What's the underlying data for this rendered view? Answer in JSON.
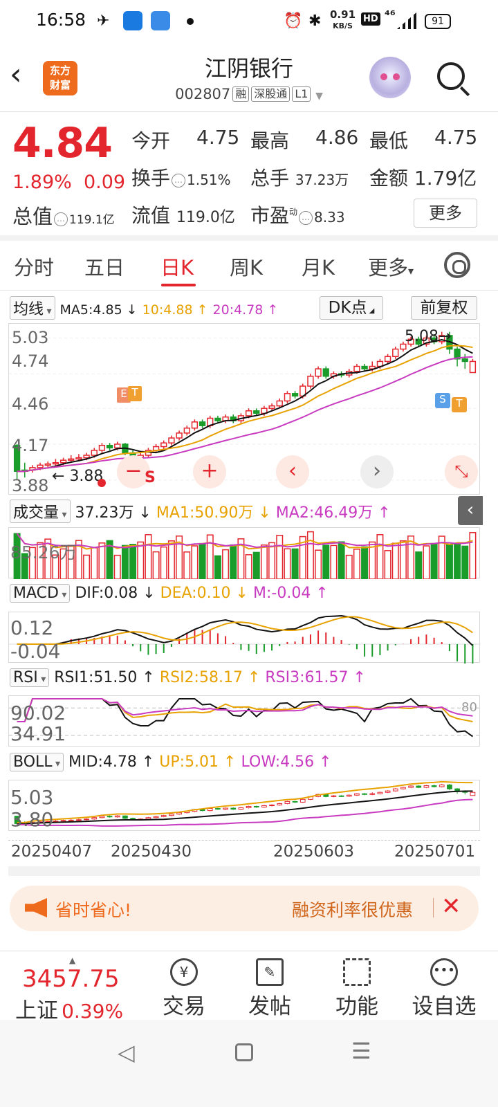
{
  "status_bar": {
    "time": "16:58",
    "speed_top": "0.91",
    "speed_bottom": "KB/S",
    "hd": "HD",
    "signal": "⁴⁶",
    "battery": "91"
  },
  "header": {
    "logo_line1": "东方",
    "logo_line2": "财富",
    "title": "江阴银行",
    "code": "002807",
    "tags": [
      "融",
      "深股通",
      "L1"
    ]
  },
  "quote": {
    "price": "4.84",
    "change_pct": "1.89%",
    "change_abs": "0.09",
    "open_label": "今开",
    "open": "4.75",
    "high_label": "最高",
    "high": "4.86",
    "low_label": "最低",
    "low": "4.75",
    "turnover_label": "换手",
    "turnover": "1.51%",
    "volume_label": "总手",
    "volume": "37.23万",
    "amount_label": "金额",
    "amount": "1.79亿",
    "mktcap_label": "总值",
    "mktcap": "119.1亿",
    "float_label": "流值",
    "float_cap": "119.0亿",
    "pe_label": "市盈",
    "pe_sup": "动",
    "pe": "8.33",
    "more": "更多"
  },
  "tabs": [
    {
      "label": "分时"
    },
    {
      "label": "五日"
    },
    {
      "label": "日K"
    },
    {
      "label": "周K"
    },
    {
      "label": "月K"
    },
    {
      "label": "更多"
    }
  ],
  "kline": {
    "selector": "均线",
    "ma5": "MA5:4.85",
    "ma10": "10:4.88",
    "ma20": "20:4.78",
    "dk_label": "DK点",
    "adjust_label": "前复权",
    "y_labels": [
      "5.03",
      "4.74",
      "4.46",
      "4.17",
      "3.88"
    ],
    "low_label": "3.88",
    "high_label": "5.08",
    "marker_e": "E",
    "marker_t": "T",
    "marker_s": "S",
    "marker_s2": "S"
  },
  "volume": {
    "selector": "成交量",
    "value": "37.23万",
    "ma1": "MA1:50.90万",
    "ma2": "MA2:46.49万",
    "axis_label": "85.26万"
  },
  "macd": {
    "selector": "MACD",
    "dif": "DIF:0.08",
    "dea": "DEA:0.10",
    "m": "M:-0.04",
    "axis_top": "0.12",
    "axis_bottom": "-0.04"
  },
  "rsi": {
    "selector": "RSI",
    "rsi1": "RSI1:51.50",
    "rsi2": "RSI2:58.17",
    "rsi3": "RSI3:61.57",
    "axis_top": "90.02",
    "axis_bottom": "34.91",
    "line_80": "80"
  },
  "boll": {
    "selector": "BOLL",
    "mid": "MID:4.78",
    "up": "UP:5.01",
    "low": "LOW:4.56",
    "axis_top": "5.03",
    "axis_bottom": "3.80"
  },
  "dates": [
    "20250407",
    "20250430",
    "20250603",
    "20250701"
  ],
  "ad": {
    "left_text": "省时省心!",
    "right_text": "融资利率很优惠"
  },
  "bottom_nav": {
    "index_value": "3457.75",
    "index_name": "上证",
    "index_pct": "0.39%",
    "items": [
      "交易",
      "发帖",
      "功能",
      "设自选"
    ]
  },
  "chart_data": {
    "type": "candlestick",
    "title": "",
    "ylim": [
      3.8,
      5.1
    ],
    "candles": [
      [
        4.16,
        3.95,
        4.17,
        3.88
      ],
      [
        3.96,
        3.95,
        4.02,
        3.9
      ],
      [
        3.96,
        3.98,
        4.0,
        3.94
      ],
      [
        3.98,
        4.0,
        4.02,
        3.96
      ],
      [
        4.0,
        4.01,
        4.03,
        3.98
      ],
      [
        4.01,
        4.02,
        4.05,
        3.99
      ],
      [
        4.02,
        4.04,
        4.06,
        4.0
      ],
      [
        4.04,
        4.05,
        4.08,
        4.02
      ],
      [
        4.05,
        4.06,
        4.09,
        4.03
      ],
      [
        4.06,
        4.08,
        4.1,
        4.04
      ],
      [
        4.08,
        4.12,
        4.14,
        4.06
      ],
      [
        4.12,
        4.16,
        4.18,
        4.1
      ],
      [
        4.16,
        4.14,
        4.18,
        4.12
      ],
      [
        4.14,
        4.17,
        4.19,
        4.12
      ],
      [
        4.17,
        4.1,
        4.18,
        4.08
      ],
      [
        4.1,
        4.06,
        4.12,
        4.04
      ],
      [
        4.06,
        4.08,
        4.1,
        4.04
      ],
      [
        4.08,
        4.12,
        4.14,
        4.06
      ],
      [
        4.12,
        4.15,
        4.17,
        4.1
      ],
      [
        4.15,
        4.18,
        4.2,
        4.13
      ],
      [
        4.18,
        4.22,
        4.24,
        4.16
      ],
      [
        4.22,
        4.26,
        4.28,
        4.2
      ],
      [
        4.26,
        4.3,
        4.32,
        4.24
      ],
      [
        4.3,
        4.35,
        4.37,
        4.28
      ],
      [
        4.35,
        4.32,
        4.37,
        4.3
      ],
      [
        4.32,
        4.38,
        4.4,
        4.3
      ],
      [
        4.38,
        4.36,
        4.4,
        4.34
      ],
      [
        4.36,
        4.39,
        4.41,
        4.34
      ],
      [
        4.39,
        4.36,
        4.41,
        4.34
      ],
      [
        4.36,
        4.4,
        4.42,
        4.34
      ],
      [
        4.4,
        4.44,
        4.46,
        4.38
      ],
      [
        4.44,
        4.42,
        4.46,
        4.4
      ],
      [
        4.42,
        4.46,
        4.48,
        4.4
      ],
      [
        4.46,
        4.48,
        4.5,
        4.44
      ],
      [
        4.48,
        4.52,
        4.54,
        4.46
      ],
      [
        4.52,
        4.58,
        4.6,
        4.5
      ],
      [
        4.58,
        4.56,
        4.6,
        4.54
      ],
      [
        4.56,
        4.64,
        4.66,
        4.54
      ],
      [
        4.64,
        4.72,
        4.74,
        4.62
      ],
      [
        4.72,
        4.78,
        4.8,
        4.7
      ],
      [
        4.78,
        4.72,
        4.8,
        4.7
      ],
      [
        4.72,
        4.74,
        4.76,
        4.7
      ],
      [
        4.74,
        4.73,
        4.76,
        4.71
      ],
      [
        4.73,
        4.76,
        4.78,
        4.71
      ],
      [
        4.76,
        4.8,
        4.82,
        4.74
      ],
      [
        4.8,
        4.78,
        4.82,
        4.76
      ],
      [
        4.78,
        4.8,
        4.84,
        4.76
      ],
      [
        4.8,
        4.84,
        4.86,
        4.78
      ],
      [
        4.84,
        4.88,
        4.9,
        4.82
      ],
      [
        4.88,
        4.94,
        4.96,
        4.86
      ],
      [
        4.94,
        4.98,
        5.0,
        4.92
      ],
      [
        4.98,
        5.02,
        5.04,
        4.96
      ],
      [
        5.02,
        4.98,
        5.04,
        4.96
      ],
      [
        4.98,
        5.03,
        5.05,
        4.96
      ],
      [
        5.03,
        5.0,
        5.06,
        4.98
      ],
      [
        5.0,
        5.05,
        5.08,
        4.98
      ],
      [
        5.05,
        4.94,
        5.08,
        4.9
      ],
      [
        4.94,
        4.86,
        4.96,
        4.8
      ],
      [
        4.86,
        4.84,
        4.9,
        4.78
      ],
      [
        4.75,
        4.84,
        4.86,
        4.75
      ]
    ]
  },
  "colors": {
    "up": "#e3262d",
    "down": "#1a9c2b",
    "ma10": "#e8a200",
    "ma20": "#c83bc0",
    "ma5": "#111111"
  }
}
